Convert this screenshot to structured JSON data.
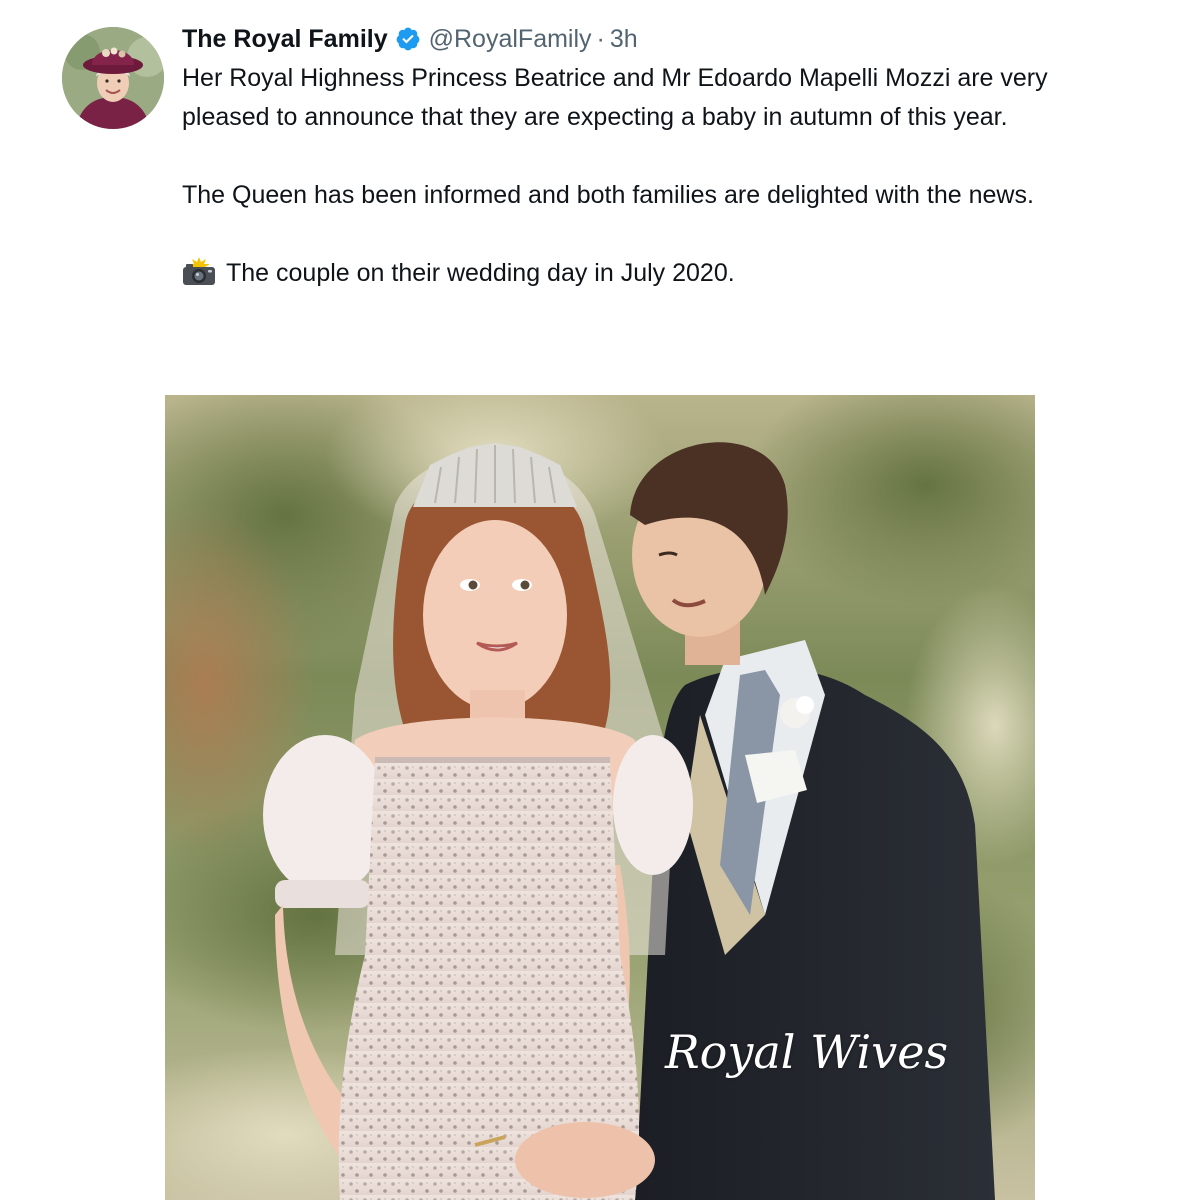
{
  "tweet": {
    "author": {
      "display_name": "The Royal Family",
      "handle": "@RoyalFamily",
      "separator": "·",
      "time": "3h",
      "verified": true
    },
    "text": {
      "paragraph_1": "Her Royal Highness Princess Beatrice and Mr Edoardo Mapelli Mozzi are very pleased to announce that they are expecting a baby in autumn of this year.",
      "paragraph_2": "The Queen has been informed and both families are delighted with the news.",
      "paragraph_3": "The couple on their wedding day in July 2020."
    },
    "media": {
      "watermark": "Royal Wives"
    }
  },
  "icons": {
    "verified": "verified-badge-icon",
    "camera": "camera-flash-icon"
  },
  "colors": {
    "primary_text": "#0f1419",
    "secondary_text": "#536471",
    "verified_blue": "#1d9bf0"
  }
}
